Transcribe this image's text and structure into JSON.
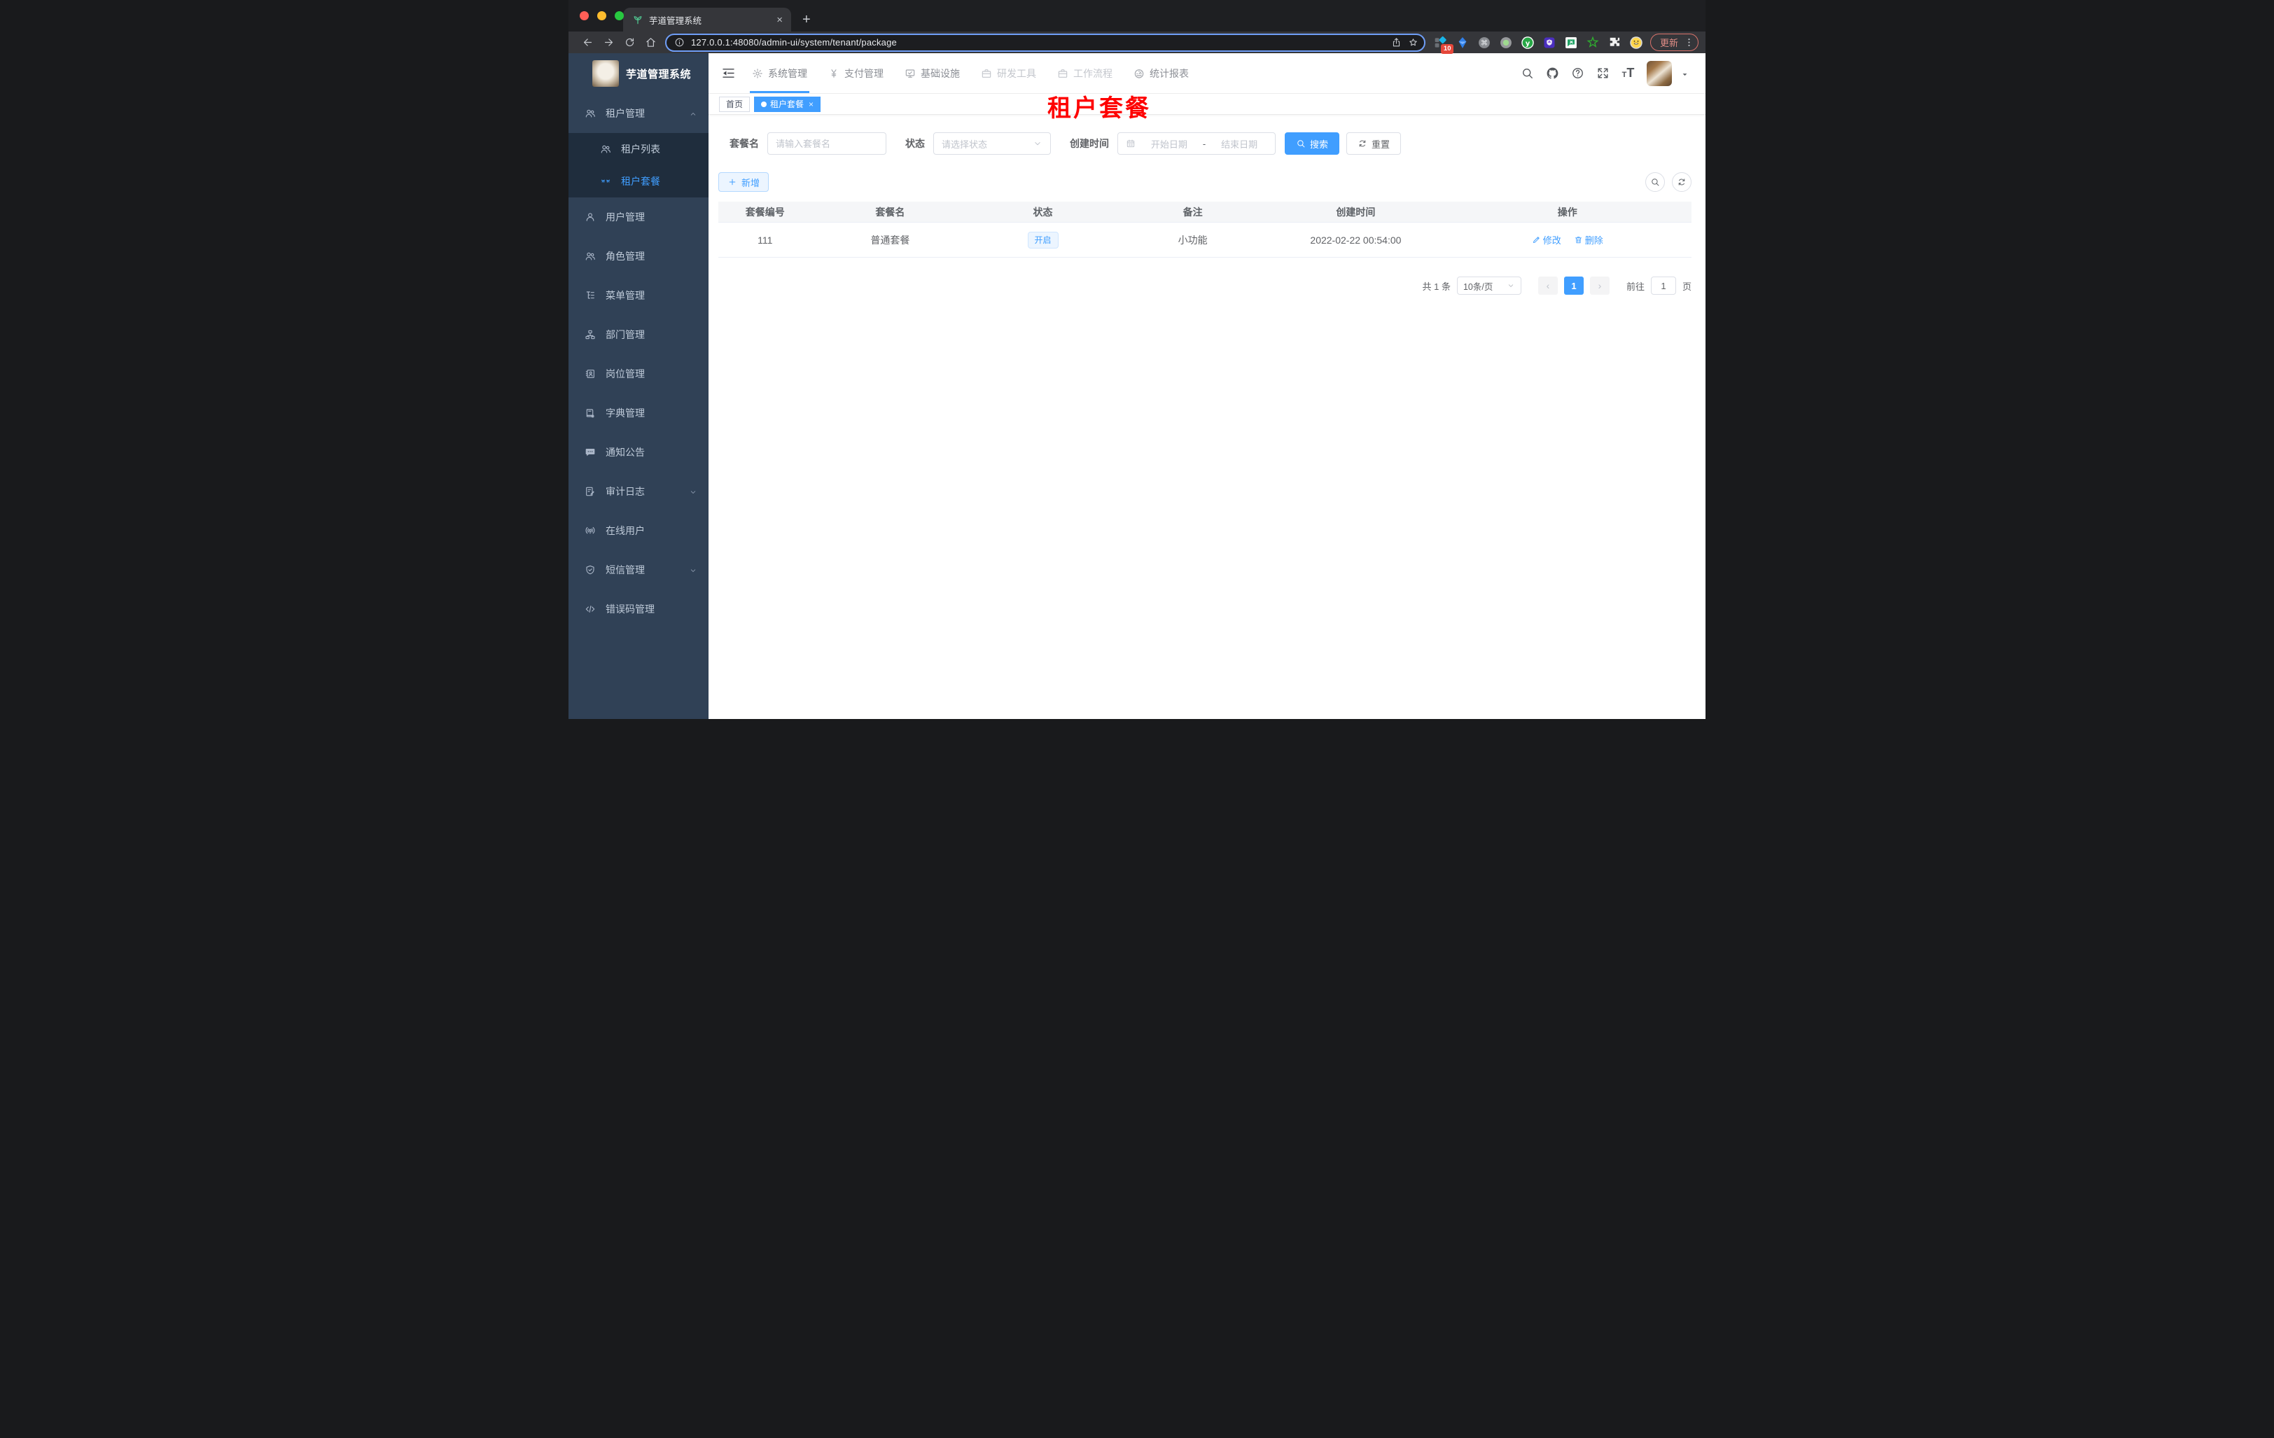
{
  "colors": {
    "accent": "#409eff",
    "sidebar_bg": "#304156",
    "submenu_bg": "#1f2d3d",
    "annotation_red": "#fe0000",
    "tab_active_bg": "#409eff"
  },
  "browser": {
    "tab_title": "芋道管理系统",
    "tab_close_glyph": "×",
    "new_tab_glyph": "+",
    "url": "127.0.0.1:48080/admin-ui/system/tenant/package",
    "extension_badge": "10",
    "update_button": "更新",
    "extensions": [
      "blue-diamond-extension-icon",
      "blue-gem-extension-icon",
      "command-extension-icon",
      "green-dot-extension-icon",
      "y-green-extension-icon",
      "purple-shield-extension-icon",
      "green-chat-extension-icon",
      "green-star-extension-icon",
      "puzzle-extension-icon",
      "emoji-profile-icon"
    ]
  },
  "sidebar": {
    "title": "芋道管理系统",
    "menu": [
      {
        "label": "租户管理",
        "icon": "users-icon",
        "expanded": true,
        "children": [
          {
            "label": "租户列表",
            "icon": "users-icon"
          },
          {
            "label": "租户套餐",
            "icon": "peoples-icon",
            "active": true
          }
        ]
      },
      {
        "label": "用户管理",
        "icon": "user-icon"
      },
      {
        "label": "角色管理",
        "icon": "users-icon"
      },
      {
        "label": "菜单管理",
        "icon": "tree-icon"
      },
      {
        "label": "部门管理",
        "icon": "org-icon"
      },
      {
        "label": "岗位管理",
        "icon": "badge-icon"
      },
      {
        "label": "字典管理",
        "icon": "dict-icon"
      },
      {
        "label": "通知公告",
        "icon": "message-icon"
      },
      {
        "label": "审计日志",
        "icon": "log-icon",
        "collapsed": true
      },
      {
        "label": "在线用户",
        "icon": "online-icon"
      },
      {
        "label": "短信管理",
        "icon": "shield-icon",
        "collapsed": true
      },
      {
        "label": "错误码管理",
        "icon": "code-icon"
      }
    ]
  },
  "header": {
    "nav": [
      {
        "label": "系统管理",
        "icon": "gear-icon",
        "active": true
      },
      {
        "label": "支付管理",
        "icon": "yen-icon"
      },
      {
        "label": "基础设施",
        "icon": "monitor-icon"
      },
      {
        "label": "研发工具",
        "icon": "briefcase-icon",
        "dim": true
      },
      {
        "label": "工作流程",
        "icon": "briefcase-icon",
        "dim": true
      },
      {
        "label": "统计报表",
        "icon": "dashboard-icon"
      }
    ],
    "icons": [
      "search-icon",
      "github-icon",
      "help-icon",
      "fullscreen-icon",
      "font-size-icon"
    ]
  },
  "tags": [
    {
      "label": "首页"
    },
    {
      "label": "租户套餐",
      "active": true,
      "closable": true
    }
  ],
  "annotation": {
    "text": "租户套餐"
  },
  "filters": {
    "name_label": "套餐名",
    "name_placeholder": "请输入套餐名",
    "status_label": "状态",
    "status_placeholder": "请选择状态",
    "date_label": "创建时间",
    "date_start_placeholder": "开始日期",
    "date_separator": "-",
    "date_end_placeholder": "结束日期",
    "search_button": "搜索",
    "reset_button": "重置"
  },
  "toolbar": {
    "add_button": "新增"
  },
  "table": {
    "headers": [
      "套餐编号",
      "套餐名",
      "状态",
      "备注",
      "创建时间",
      "操作"
    ],
    "rows": [
      {
        "id": "111",
        "name": "普通套餐",
        "status": "开启",
        "remark": "小功能",
        "created_at": "2022-02-22 00:54:00",
        "actions": [
          "修改",
          "删除"
        ]
      }
    ]
  },
  "pagination": {
    "total_text": "共 1 条",
    "page_size": "10条/页",
    "prev_glyph": "‹",
    "current_page": "1",
    "next_glyph": "›",
    "goto_label": "前往",
    "goto_value": "1",
    "page_unit": "页"
  }
}
